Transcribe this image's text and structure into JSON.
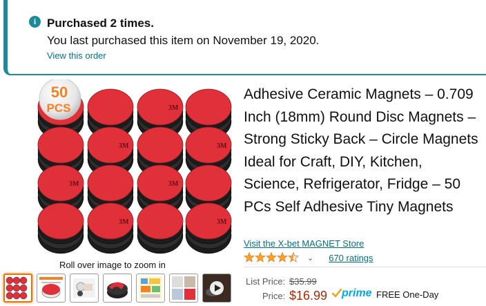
{
  "alert": {
    "icon": "info-icon",
    "title": "Purchased 2 times.",
    "text": "You last purchased this item on November 19, 2020.",
    "link": "View this order",
    "color": "#1B8A9A"
  },
  "gallery": {
    "badge_number": "50",
    "badge_unit": "PCS",
    "magnet_label": "3M",
    "zoom_hint": "Roll over image to zoom in",
    "thumbnails": [
      {
        "name": "thumb-magnets-grid",
        "active": true
      },
      {
        "name": "thumb-size-chart",
        "active": false
      },
      {
        "name": "thumb-application",
        "active": false
      },
      {
        "name": "thumb-magnet-closeup",
        "active": false
      },
      {
        "name": "thumb-ideas",
        "active": false
      },
      {
        "name": "thumb-usage-grid",
        "active": false
      },
      {
        "name": "thumb-video",
        "active": false
      }
    ]
  },
  "product": {
    "title": "Adhesive Ceramic Magnets – 0.709 Inch (18mm) Round Disc Magnets – Strong Sticky Back – Circle Magnets Ideal for Craft, DIY, Kitchen, Science, Refrigerator, Fridge – 50 PCs Self Adhesive Tiny Magnets",
    "store_link": "Visit the X-bet MAGNET Store",
    "rating_stars": 4.5,
    "ratings_count": "670 ratings",
    "list_price_label": "List Price:",
    "list_price": "$35.99",
    "price_label": "Price:",
    "price": "$16.99",
    "prime_label": "prime",
    "delivery": "FREE One-Day"
  },
  "colors": {
    "link": "#007185",
    "price": "#B12704",
    "star": "#FFA41C",
    "prime": "#00A8E1",
    "magnet_red": "#E0303A"
  }
}
